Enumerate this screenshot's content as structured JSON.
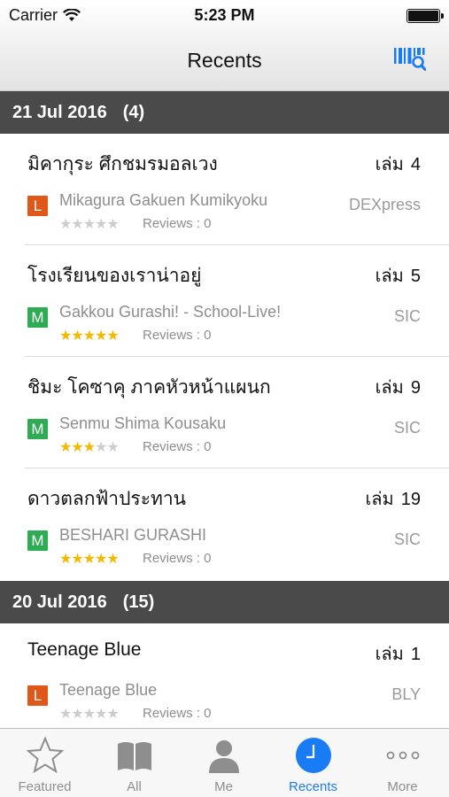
{
  "status_bar": {
    "carrier": "Carrier",
    "time": "5:23 PM"
  },
  "nav": {
    "title": "Recents",
    "scan_icon": "barcode-search-icon"
  },
  "sections": [
    {
      "date": "21 Jul 2016",
      "count": "(4)",
      "items": [
        {
          "title": "มิคากุระ ศึกชมรมอลเวง",
          "volume_label": "เล่ม",
          "volume": "4",
          "type": "L",
          "roman": "Mikagura Gakuen Kumikyoku",
          "publisher": "DEXpress",
          "rating": 0,
          "reviews": "Reviews : 0"
        },
        {
          "title": "โรงเรียนของเราน่าอยู่",
          "volume_label": "เล่ม",
          "volume": "5",
          "type": "M",
          "roman": "Gakkou Gurashi! - School-Live!",
          "publisher": "SIC",
          "rating": 5,
          "reviews": "Reviews : 0"
        },
        {
          "title": "ชิมะ โคซาคุ ภาคหัวหน้าแผนก",
          "volume_label": "เล่ม",
          "volume": "9",
          "type": "M",
          "roman": "Senmu Shima Kousaku",
          "publisher": "SIC",
          "rating": 3,
          "reviews": "Reviews : 0"
        },
        {
          "title": "ดาวตลกฟ้าประทาน",
          "volume_label": "เล่ม",
          "volume": "19",
          "type": "M",
          "roman": "BESHARI GURASHI",
          "publisher": "SIC",
          "rating": 5,
          "reviews": "Reviews : 0"
        }
      ]
    },
    {
      "date": "20 Jul 2016",
      "count": "(15)",
      "items": [
        {
          "title": "Teenage Blue",
          "volume_label": "เล่ม",
          "volume": "1",
          "type": "L",
          "roman": "Teenage Blue",
          "publisher": "BLY",
          "rating": 0,
          "reviews": "Reviews : 0"
        }
      ]
    }
  ],
  "tabs": [
    {
      "label": "Featured",
      "icon": "star-icon"
    },
    {
      "label": "All",
      "icon": "book-icon"
    },
    {
      "label": "Me",
      "icon": "person-icon"
    },
    {
      "label": "Recents",
      "icon": "clock-icon",
      "active": true
    },
    {
      "label": "More",
      "icon": "more-icon"
    }
  ],
  "colors": {
    "accent": "#1a7cf5",
    "section_bg": "#4a4a4a",
    "light_novel_badge": "#e0571a",
    "manga_badge": "#2dac53",
    "star": "#f5b800"
  }
}
